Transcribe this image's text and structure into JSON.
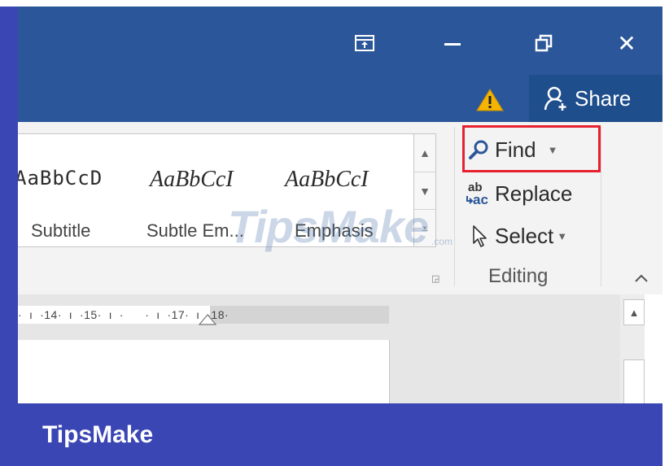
{
  "titlebar": {
    "ribbon_display_icon": "ribbon-display-options-icon",
    "minimize_icon": "minimize-icon",
    "restore_icon": "restore-icon",
    "close_label": "✕",
    "background": "#2b579a"
  },
  "tellme": {
    "warning_icon": "warning-icon",
    "share_label": "Share",
    "share_icon": "share-person-icon"
  },
  "styles": {
    "items": [
      {
        "sample": "AaBbCcD",
        "name": "Subtitle"
      },
      {
        "sample": "AaBbCcI",
        "name": "Subtle Em..."
      },
      {
        "sample": "AaBbCcI",
        "name": "Emphasis"
      }
    ]
  },
  "editing": {
    "find_label": "Find",
    "replace_label": "Replace",
    "select_label": "Select",
    "group_label": "Editing",
    "highlight_color": "#e6202f"
  },
  "ruler": {
    "scale_text": "·  ı  ·14·  ı  ·15·  ı  ·      ·  ı  ·17·  ı  ·18·"
  },
  "watermark": {
    "text": "TipsMake",
    "small": ".com"
  },
  "footer": {
    "brand": "TipsMake",
    "background": "#3b46b5"
  }
}
